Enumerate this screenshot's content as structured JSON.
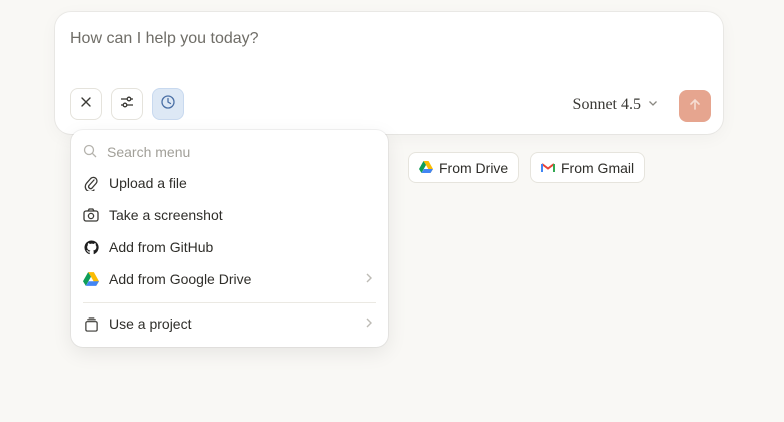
{
  "composer": {
    "placeholder": "How can I help you today?",
    "model_label": "Sonnet 4.5"
  },
  "tools": [
    {
      "name": "close",
      "icon": "close-icon"
    },
    {
      "name": "settings",
      "icon": "sliders-icon"
    },
    {
      "name": "history",
      "icon": "clock-icon"
    }
  ],
  "menu": {
    "search_placeholder": "Search menu",
    "items": [
      {
        "label": "Upload a file",
        "icon": "paperclip-icon"
      },
      {
        "label": "Take a screenshot",
        "icon": "camera-icon"
      },
      {
        "label": "Add from GitHub",
        "icon": "github-icon"
      },
      {
        "label": "Add from Google Drive",
        "icon": "google-drive-icon",
        "has_submenu": true
      },
      {
        "label": "Use a project",
        "icon": "project-icon",
        "has_submenu": true
      }
    ]
  },
  "chips": {
    "drive_label": "From Drive",
    "gmail_label": "From Gmail"
  },
  "colors": {
    "background": "#f9f8f5",
    "accent_send": "#e6a58f",
    "active_tool": "#dde8f5"
  }
}
